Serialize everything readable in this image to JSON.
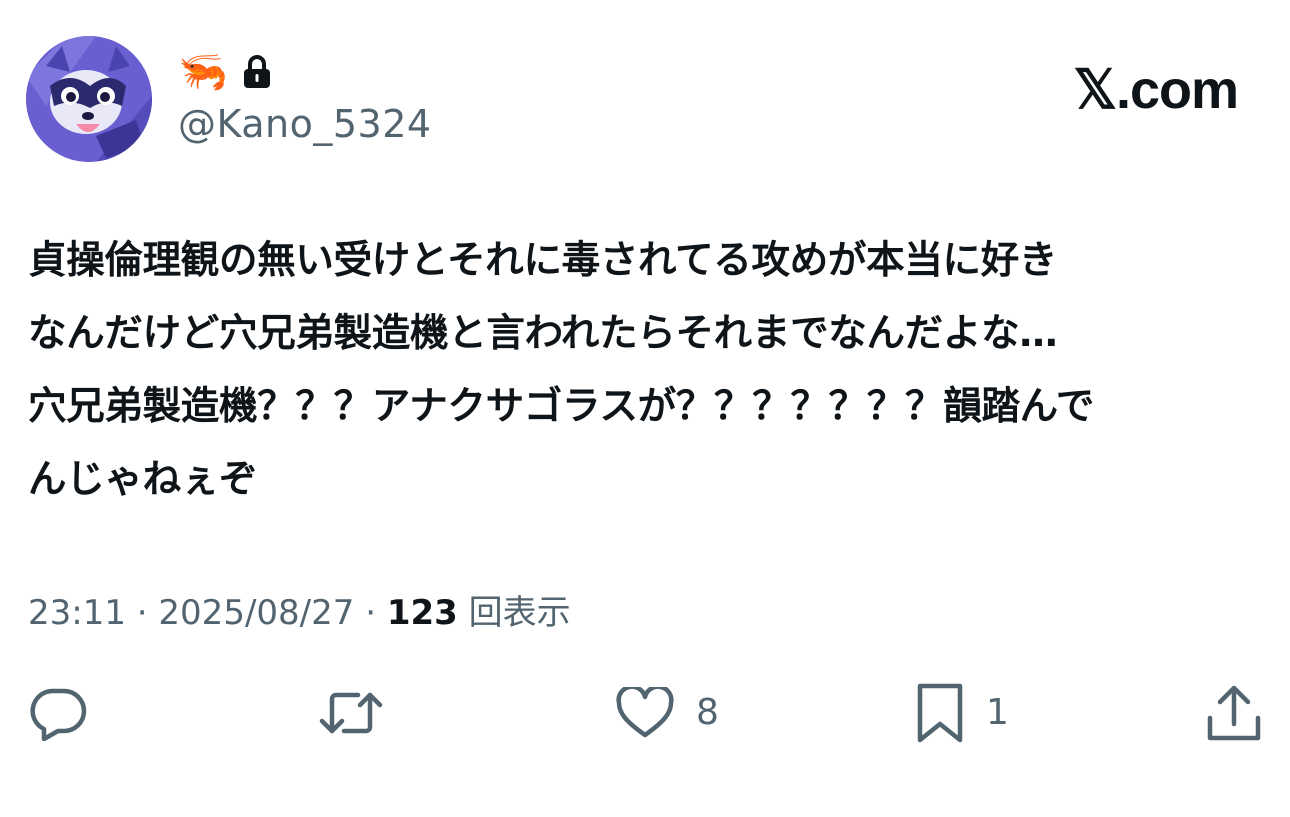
{
  "header": {
    "display_name": "🦐",
    "handle": "@Kano_5324",
    "brand": "𝕏.com"
  },
  "tweet": {
    "lines": [
      "貞操倫理観の無い受けとそれに毒されてる攻めが本当に好き",
      "なんだけど穴兄弟製造機と言われたらそれまでなんだよな…",
      "穴兄弟製造機？？？アナクサゴラスが？？？？？？？韻踏んで",
      "んじゃねぇぞ"
    ]
  },
  "meta": {
    "time": "23:11",
    "separator": " · ",
    "date": "2025/08/27",
    "views_count": "123",
    "views_label": "回表示"
  },
  "actions": {
    "reply_count": "",
    "retweet_count": "",
    "like_count": "8",
    "bookmark_count": "1"
  },
  "colors": {
    "text": "#0f1419",
    "secondary": "#536471",
    "background": "#ffffff"
  },
  "icons": [
    "lock-icon",
    "reply-icon",
    "retweet-icon",
    "like-icon",
    "bookmark-icon",
    "share-icon"
  ]
}
